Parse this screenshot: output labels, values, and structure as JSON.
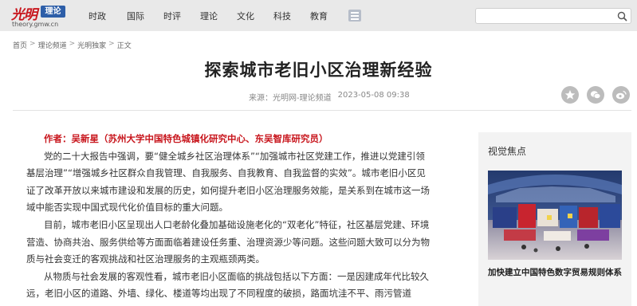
{
  "site": {
    "logo_mark": "光明",
    "logo_tag": "理论",
    "logo_domain": "theory.gmw.cn"
  },
  "nav": {
    "items": [
      "时政",
      "国际",
      "时评",
      "理论",
      "文化",
      "科技",
      "教育"
    ]
  },
  "search": {
    "value": "",
    "placeholder": ""
  },
  "breadcrumb": {
    "items": [
      "首页",
      "理论频道",
      "光明独家",
      "正文"
    ],
    "separator": ">"
  },
  "article": {
    "title": "探索城市老旧小区治理新经验",
    "source": "来源：光明网-理论频道",
    "date": "2023-05-08 09:38",
    "author": "作者：吴新星（苏州大学中国特色城镇化研究中心、东吴智库研究员）",
    "paragraphs": [
      "党的二十大报告中强调，要“健全城乡社区治理体系”“加强城市社区党建工作，推进以党建引领基层治理”“增强城乡社区群众自我管理、自我服务、自我教育、自我监督的实效”。城市老旧小区见证了改革开放以来城市建设和发展的历史，如何提升老旧小区治理服务效能，是关系到在城市这一场域中能否实现中国式现代化价值目标的重大问题。",
      "目前，城市老旧小区呈现出人口老龄化叠加基础设施老化的“双老化”特征，社区基层党建、环境营造、协商共治、服务供给等方面面临着建设任务重、治理资源少等问题。这些问题大致可以分为物质与社会变迁的客观挑战和社区治理服务的主观瓶颈两类。",
      "从物质与社会发展的客观性看，城市老旧小区面临的挑战包括以下方面：一是因建成年代比较久远，老旧小区的道路、外墙、绿化、楼道等均出现了不同程度的破损，路面坑洼不平、雨污管道"
    ]
  },
  "share": {
    "icons": [
      "star-icon",
      "wechat-icon",
      "weibo-icon"
    ]
  },
  "sidebar": {
    "heading": "视觉焦点",
    "caption": "加快建立中国特色数字贸易规则体系"
  },
  "colors": {
    "brand_red": "#c8161d",
    "nav_bg": "#e9e9e9",
    "tag_blue": "#2d5ea8"
  }
}
